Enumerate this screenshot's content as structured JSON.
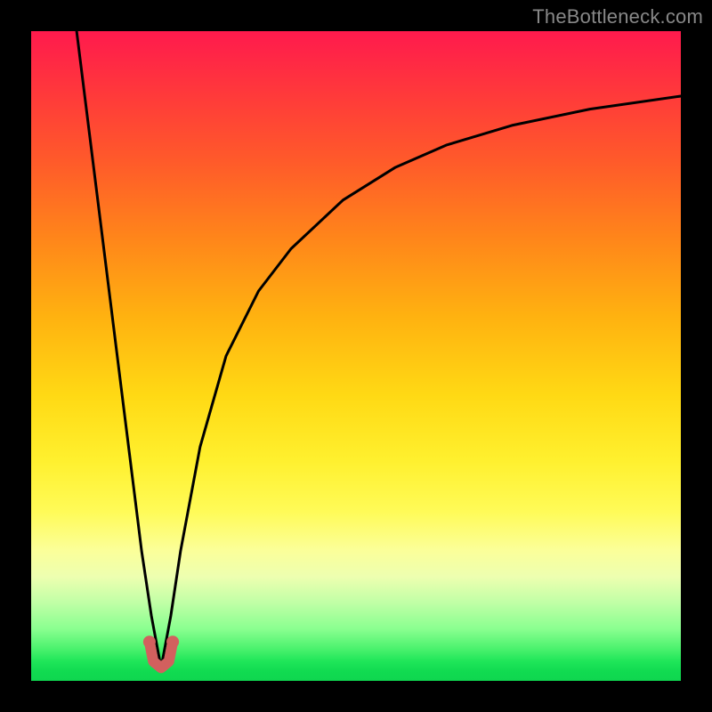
{
  "watermark": "TheBottleneck.com",
  "chart_data": {
    "type": "line",
    "title": "",
    "xlabel": "",
    "ylabel": "",
    "xlim": [
      0,
      100
    ],
    "ylim": [
      0,
      100
    ],
    "grid": false,
    "legend": false,
    "optimum_x": 20,
    "series": [
      {
        "name": "bottleneck-curve",
        "x": [
          7,
          9,
          11,
          13,
          15,
          17,
          18.5,
          20,
          21.5,
          23,
          26,
          30,
          35,
          40,
          48,
          56,
          64,
          74,
          86,
          100
        ],
        "y": [
          100,
          84,
          68,
          52,
          36,
          20,
          10,
          2,
          10,
          20,
          36,
          50,
          60,
          66.5,
          74,
          79,
          82.5,
          85.5,
          88,
          90
        ]
      },
      {
        "name": "optimal-marker",
        "x": [
          18.2,
          18.8,
          20,
          21.2,
          21.8
        ],
        "y": [
          6,
          3,
          2,
          3,
          6
        ]
      }
    ]
  }
}
